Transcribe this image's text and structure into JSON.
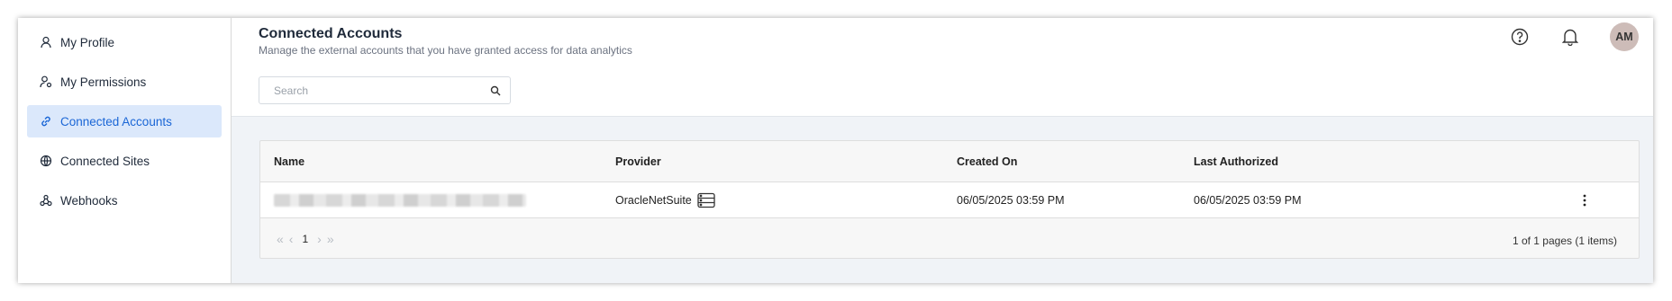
{
  "sidebar": {
    "items": [
      {
        "label": "My Profile",
        "icon": "user-icon"
      },
      {
        "label": "My Permissions",
        "icon": "user-gear-icon"
      },
      {
        "label": "Connected Accounts",
        "icon": "link-icon",
        "active": true
      },
      {
        "label": "Connected Sites",
        "icon": "globe-icon"
      },
      {
        "label": "Webhooks",
        "icon": "webhook-icon"
      }
    ]
  },
  "header": {
    "title": "Connected Accounts",
    "subtitle": "Manage the external accounts that you have granted access for data analytics",
    "avatar_initials": "AM"
  },
  "search": {
    "placeholder": "Search",
    "value": ""
  },
  "table": {
    "columns": [
      "Name",
      "Provider",
      "Created On",
      "Last Authorized"
    ],
    "rows": [
      {
        "provider": "OracleNetSuite",
        "provider_icon": "database-icon",
        "created_on": "06/05/2025 03:59 PM",
        "last_authorized": "06/05/2025 03:59 PM"
      }
    ]
  },
  "pager": {
    "page": "1",
    "info": "1 of 1 pages (1 items)"
  },
  "colors": {
    "accent": "#1a66d6",
    "active_bg": "#dbe8fb",
    "avatar_bg": "#cdbcb8",
    "content_bg": "#f0f3f7"
  }
}
